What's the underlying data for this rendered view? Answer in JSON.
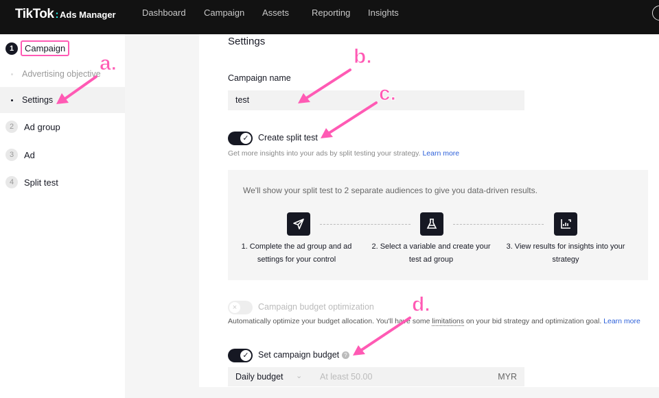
{
  "header": {
    "logo": "TikTok",
    "logo_sep": ":",
    "product": "Ads Manager",
    "nav": [
      "Dashboard",
      "Campaign",
      "Assets",
      "Reporting",
      "Insights"
    ]
  },
  "sidebar": {
    "steps": [
      {
        "num": "1",
        "label": "Campaign",
        "active": true
      },
      {
        "num": "2",
        "label": "Ad group"
      },
      {
        "num": "3",
        "label": "Ad"
      },
      {
        "num": "4",
        "label": "Split test"
      }
    ],
    "sub_items": [
      "Advertising objective",
      "Settings"
    ]
  },
  "main": {
    "title": "Settings",
    "campaign_name_label": "Campaign name",
    "campaign_name_value": "test",
    "split_test": {
      "label": "Create split test",
      "enabled": true,
      "desc": "Get more insights into your ads by split testing your strategy.",
      "learn_more": "Learn more",
      "intro": "We'll show your split test to 2 separate audiences to give you data-driven results.",
      "steps": [
        {
          "icon": "send-icon",
          "text": "1. Complete the ad group and ad settings for your control"
        },
        {
          "icon": "flask-icon",
          "text": "2. Select a variable and create your test ad group"
        },
        {
          "icon": "chart-icon",
          "text": "3. View results for insights into your strategy"
        }
      ]
    },
    "cbo": {
      "label": "Campaign budget optimization",
      "enabled": false,
      "desc_a": "Automatically optimize your budget allocation. You'll have some ",
      "desc_link": "limitations",
      "desc_b": " on your bid strategy and optimization goal.",
      "learn_more": "Learn more"
    },
    "budget": {
      "label": "Set campaign budget",
      "enabled": true,
      "type": "Daily budget",
      "placeholder": "At least 50.00",
      "currency": "MYR"
    }
  },
  "annotations": [
    "a.",
    "b.",
    "c.",
    "d."
  ],
  "colors": {
    "annotation": "#ff5ab4",
    "link": "#2b5fd9",
    "header": "#121212"
  }
}
